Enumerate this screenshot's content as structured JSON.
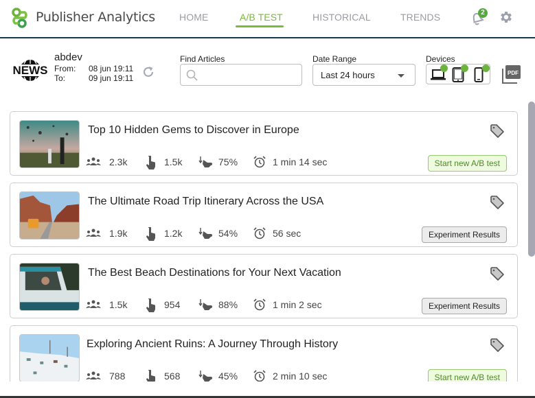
{
  "app": {
    "title": "Publisher Analytics",
    "brand_color": "#7ab93b",
    "header_border_color": "#16384a"
  },
  "nav": {
    "items": [
      {
        "label": "HOME",
        "active": false
      },
      {
        "label": "A/B TEST",
        "active": true
      },
      {
        "label": "HISTORICAL",
        "active": false
      },
      {
        "label": "TRENDS",
        "active": false
      }
    ],
    "notification_count": "2",
    "notification_icon": "bell-icon",
    "settings_icon": "gear-icon"
  },
  "toolbar": {
    "logo_text": "NEWS",
    "account": "abdev",
    "from_label": "From:",
    "from_value": "08 jun 19:11",
    "to_label": "To:",
    "to_value": "09 jun 19:11",
    "refresh_icon": "refresh-icon",
    "search": {
      "label": "Find Articles",
      "value": "",
      "placeholder": ""
    },
    "date_range": {
      "label": "Date Range",
      "selected": "Last 24 hours"
    },
    "devices": {
      "label": "Devices",
      "items": [
        {
          "name": "desktop",
          "checked": true
        },
        {
          "name": "tablet",
          "checked": true
        },
        {
          "name": "mobile",
          "checked": true
        }
      ]
    },
    "export_icon": "pdf-icon"
  },
  "articles": [
    {
      "title": "Top 10 Hidden Gems to Discover in Europe",
      "visitors": "2.3k",
      "clicks": "1.5k",
      "scroll": "75%",
      "time": "1 min 14 sec",
      "action": "Start new A/B test",
      "action_type": "start",
      "thumb": "hot-air-balloons-photo"
    },
    {
      "title": "The Ultimate Road Trip Itinerary Across the USA",
      "visitors": "1.9k",
      "clicks": "1.2k",
      "scroll": "54%",
      "time": "56 sec",
      "action": "Experiment Results",
      "action_type": "results",
      "thumb": "canyon-road-van-photo"
    },
    {
      "title": "The Best Beach Destinations for Your Next Vacation",
      "visitors": "1.5k",
      "clicks": "954",
      "scroll": "88%",
      "time": "1 min 2 sec",
      "action": "Experiment Results",
      "action_type": "results",
      "thumb": "vintage-truck-photo"
    },
    {
      "title": "Exploring Ancient Ruins: A Journey Through History",
      "visitors": "788",
      "clicks": "568",
      "scroll": "45%",
      "time": "2 min 10 sec",
      "action": "Start new A/B test",
      "action_type": "start",
      "thumb": "white-village-photo"
    }
  ]
}
